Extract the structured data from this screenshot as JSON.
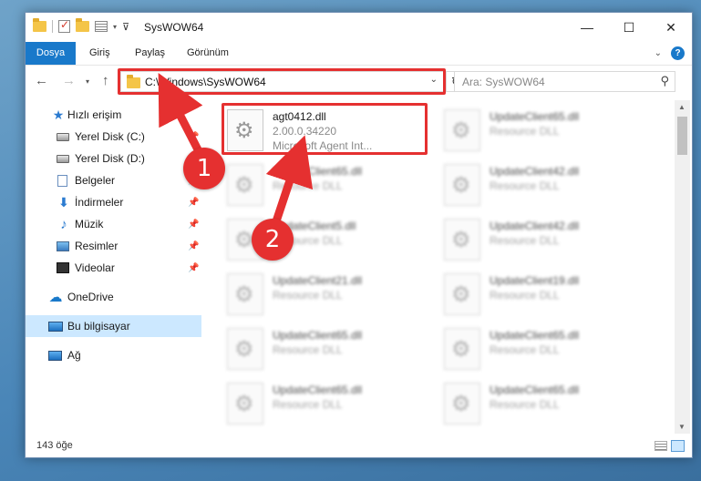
{
  "window": {
    "title": "SysWOW64",
    "buttons": {
      "minimize": "—",
      "maximize": "☐",
      "close": "✕"
    }
  },
  "ribbon": {
    "tabs": [
      "Dosya",
      "Giriş",
      "Paylaş",
      "Görünüm"
    ],
    "help": "?"
  },
  "navbar": {
    "address": "C:\\Windows\\SysWOW64",
    "search_placeholder": "Ara: SysWOW64"
  },
  "sidebar": {
    "quick_access": "Hızlı erişim",
    "items": [
      "Yerel Disk (C:)",
      "Yerel Disk (D:)",
      "Belgeler",
      "İndirmeler",
      "Müzik",
      "Resimler",
      "Videolar"
    ],
    "onedrive": "OneDrive",
    "this_pc": "Bu bilgisayar",
    "network": "Ağ"
  },
  "files": {
    "highlighted": {
      "name": "agt0412.dll",
      "version": "2.00.0.34220",
      "description": "Microsoft Agent Int..."
    },
    "left_column": [
      {
        "name": "UpdateClient65.dll",
        "type": "Resource DLL"
      },
      {
        "name": "UpdateClient5.dll",
        "type": "Resource DLL"
      },
      {
        "name": "UpdateClient21.dll",
        "type": "Resource DLL"
      },
      {
        "name": "UpdateClient65.dll",
        "type": "Resource DLL"
      },
      {
        "name": "UpdateClient65.dll",
        "type": "Resource DLL"
      }
    ],
    "right_column": [
      {
        "name": "UpdateClient65.dll",
        "type": "Resource DLL"
      },
      {
        "name": "UpdateClient42.dll",
        "type": "Resource DLL"
      },
      {
        "name": "UpdateClient42.dll",
        "type": "Resource DLL"
      },
      {
        "name": "UpdateClient19.dll",
        "type": "Resource DLL"
      },
      {
        "name": "UpdateClient65.dll",
        "type": "Resource DLL"
      },
      {
        "name": "UpdateClient65.dll",
        "type": "Resource DLL"
      }
    ]
  },
  "status": {
    "count": "143 öğe"
  },
  "annotations": {
    "step1": "1",
    "step2": "2",
    "color": "#e53030"
  }
}
